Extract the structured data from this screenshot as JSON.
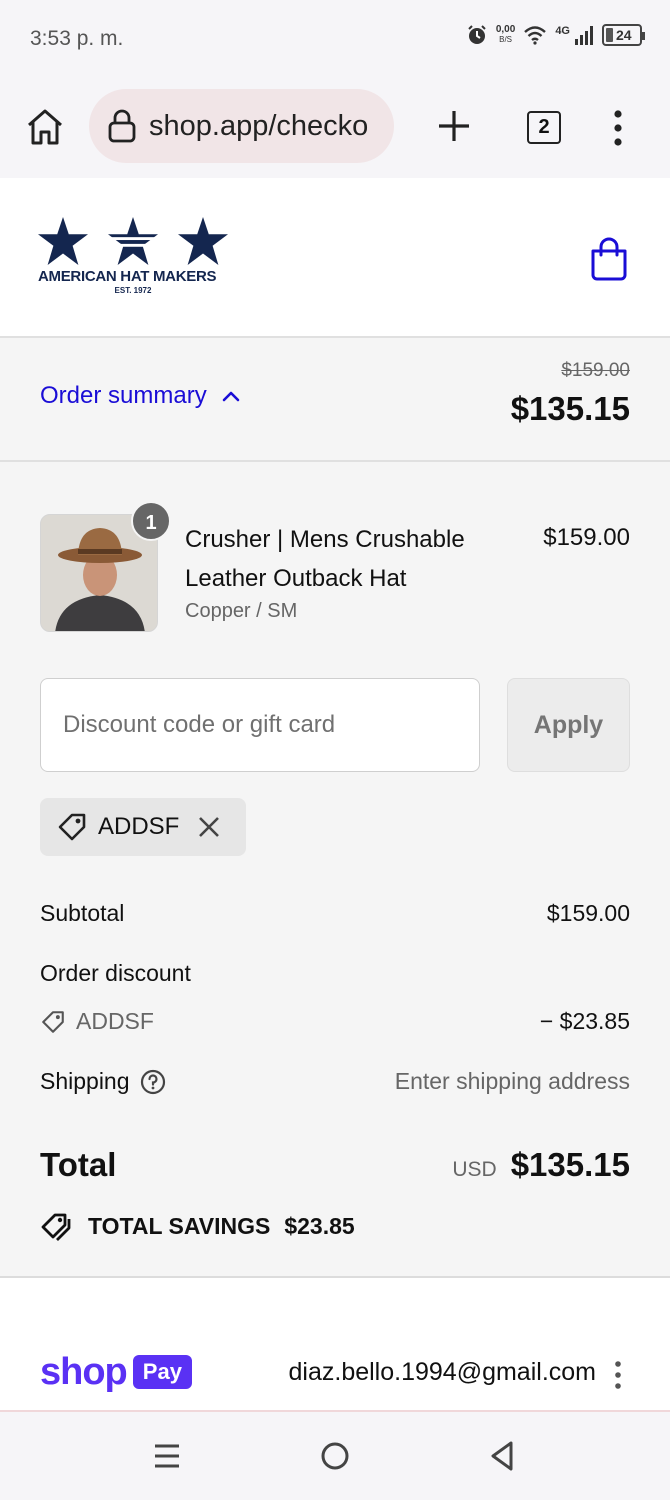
{
  "status_bar": {
    "time": "3:53 p. m.",
    "net_speed_value": "0,00",
    "net_speed_unit": "B/S",
    "network_type": "4G",
    "battery": "24"
  },
  "browser": {
    "url": "shop.app/checko",
    "tab_count": "2"
  },
  "store": {
    "logo_name": "AMERICAN HAT MAKERS",
    "logo_est": "EST. 1972",
    "brand_color": "#14264f"
  },
  "summary": {
    "toggle_label": "Order summary",
    "original_price": "$159.00",
    "total": "$135.15"
  },
  "product": {
    "quantity": "1",
    "title": "Crusher | Mens Crushable Leather Outback Hat",
    "variant": "Copper / SM",
    "price": "$159.00"
  },
  "discount": {
    "placeholder": "Discount code or gift card",
    "apply_label": "Apply",
    "applied_code": "ADDSF"
  },
  "totals": {
    "subtotal_label": "Subtotal",
    "subtotal_value": "$159.00",
    "order_discount_label": "Order discount",
    "discount_code": "ADDSF",
    "discount_value": "− $23.85",
    "shipping_label": "Shipping",
    "shipping_value": "Enter shipping address",
    "total_label": "Total",
    "currency": "USD",
    "total_value": "$135.15",
    "savings_label": "TOTAL SAVINGS",
    "savings_value": "$23.85"
  },
  "shop_pay": {
    "shop_word": "shop",
    "pay_word": "Pay",
    "email": "diaz.bello.1994@gmail.com",
    "brand_color": "#5a31f4"
  },
  "colors": {
    "link": "#1a0dd6",
    "background": "#f5f5f5"
  }
}
